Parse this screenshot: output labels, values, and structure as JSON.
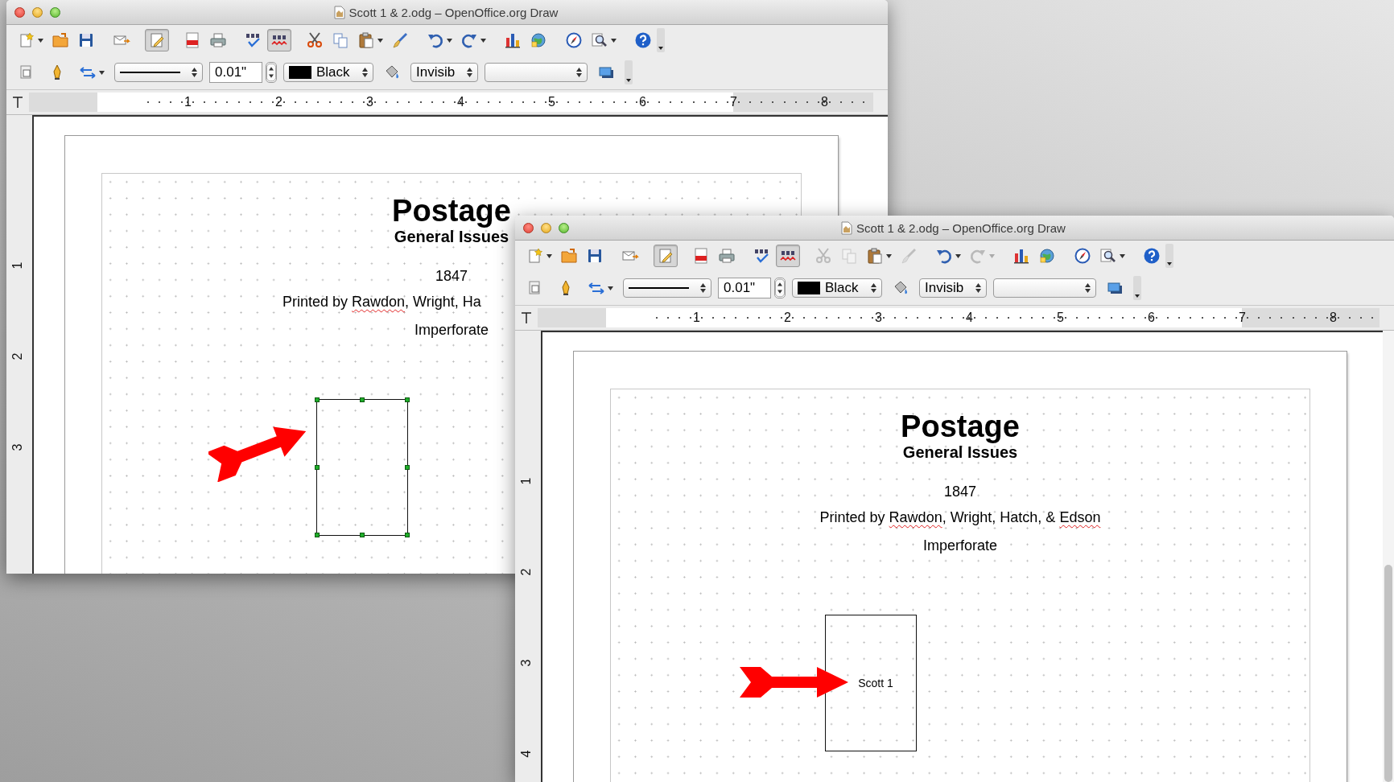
{
  "windows": [
    {
      "title": "Scott 1 & 2.odg – OpenOffice.org Draw",
      "standard_toolbar": [
        {
          "kind": "new",
          "dropdown": true,
          "disabled": false,
          "on": false
        },
        {
          "kind": "open",
          "dropdown": false,
          "disabled": false,
          "on": false
        },
        {
          "kind": "save",
          "dropdown": false,
          "disabled": false,
          "on": false
        },
        {
          "kind": "email",
          "dropdown": false,
          "disabled": false,
          "on": false
        },
        {
          "kind": "edit",
          "dropdown": false,
          "disabled": false,
          "on": true
        },
        {
          "kind": "pdf",
          "dropdown": false,
          "disabled": false,
          "on": false
        },
        {
          "kind": "print",
          "dropdown": false,
          "disabled": false,
          "on": false
        },
        {
          "kind": "spell",
          "dropdown": false,
          "disabled": false,
          "on": false
        },
        {
          "kind": "autospell",
          "dropdown": false,
          "disabled": false,
          "on": true
        },
        {
          "kind": "cut",
          "dropdown": false,
          "disabled": false,
          "on": false
        },
        {
          "kind": "copy",
          "dropdown": false,
          "disabled": false,
          "on": false
        },
        {
          "kind": "paste",
          "dropdown": true,
          "disabled": false,
          "on": false
        },
        {
          "kind": "brush",
          "dropdown": false,
          "disabled": false,
          "on": false
        },
        {
          "kind": "undo",
          "dropdown": true,
          "disabled": false,
          "on": false
        },
        {
          "kind": "redo",
          "dropdown": true,
          "disabled": false,
          "on": false
        },
        {
          "kind": "chart",
          "dropdown": false,
          "disabled": false,
          "on": false
        },
        {
          "kind": "gallery",
          "dropdown": false,
          "disabled": false,
          "on": false
        },
        {
          "kind": "navigator",
          "dropdown": false,
          "disabled": false,
          "on": false
        },
        {
          "kind": "zoom",
          "dropdown": true,
          "disabled": false,
          "on": false
        },
        {
          "kind": "help",
          "dropdown": false,
          "disabled": false,
          "on": false
        }
      ],
      "line_toolbar": [
        {
          "kind": "line-dialog"
        },
        {
          "kind": "pen"
        },
        {
          "kind": "arrows"
        },
        {
          "kind": "style-select"
        },
        {
          "kind": "width-field",
          "value": "0.01\""
        },
        {
          "kind": "spinner"
        },
        {
          "kind": "color-select",
          "label": "Black",
          "color": "#000000"
        },
        {
          "kind": "area-dialog"
        },
        {
          "kind": "fill-select",
          "label": "Invisib"
        },
        {
          "kind": "empty-select"
        },
        {
          "kind": "shadow"
        },
        {
          "kind": "more"
        }
      ],
      "h_ruler": [
        "1",
        "2",
        "3",
        "4",
        "5",
        "6",
        "7",
        "8"
      ],
      "v_ruler": [
        "1",
        "2",
        "3"
      ],
      "lines": [
        {
          "kind": "title",
          "text": "Postage",
          "cut_off": false
        },
        {
          "kind": "subtitle",
          "text": "General Issues",
          "cut_off": false
        },
        {
          "kind": "body",
          "text": "1847",
          "cut_off": false
        },
        {
          "kind": "body",
          "segments": [
            {
              "text": "Printed by ",
              "misspelled": false
            },
            {
              "text": "Rawdon",
              "misspelled": true
            },
            {
              "text": ", Wright, Ha",
              "misspelled": false
            }
          ],
          "cut_off": true
        },
        {
          "kind": "body",
          "text": "Imperforate",
          "cut_off": false
        }
      ],
      "arrow": {
        "kind": "diagonal"
      },
      "rectangle": {
        "selected": true
      }
    },
    {
      "title": "Scott 1 & 2.odg – OpenOffice.org Draw",
      "standard_toolbar": [
        {
          "kind": "new",
          "dropdown": true,
          "disabled": false,
          "on": false
        },
        {
          "kind": "open",
          "dropdown": false,
          "disabled": false,
          "on": false
        },
        {
          "kind": "save",
          "dropdown": false,
          "disabled": false,
          "on": false
        },
        {
          "kind": "email",
          "dropdown": false,
          "disabled": false,
          "on": false
        },
        {
          "kind": "edit",
          "dropdown": false,
          "disabled": false,
          "on": true
        },
        {
          "kind": "pdf",
          "dropdown": false,
          "disabled": false,
          "on": false
        },
        {
          "kind": "print",
          "dropdown": false,
          "disabled": false,
          "on": false
        },
        {
          "kind": "spell",
          "dropdown": false,
          "disabled": false,
          "on": false
        },
        {
          "kind": "autospell",
          "dropdown": false,
          "disabled": false,
          "on": true
        },
        {
          "kind": "cut",
          "dropdown": false,
          "disabled": true,
          "on": false
        },
        {
          "kind": "copy",
          "dropdown": false,
          "disabled": true,
          "on": false
        },
        {
          "kind": "paste",
          "dropdown": true,
          "disabled": false,
          "on": false
        },
        {
          "kind": "brush",
          "dropdown": false,
          "disabled": true,
          "on": false
        },
        {
          "kind": "undo",
          "dropdown": true,
          "disabled": false,
          "on": false
        },
        {
          "kind": "redo",
          "dropdown": true,
          "disabled": true,
          "on": false
        },
        {
          "kind": "chart",
          "dropdown": false,
          "disabled": false,
          "on": false
        },
        {
          "kind": "gallery",
          "dropdown": false,
          "disabled": false,
          "on": false
        },
        {
          "kind": "navigator",
          "dropdown": false,
          "disabled": false,
          "on": false
        },
        {
          "kind": "zoom",
          "dropdown": true,
          "disabled": false,
          "on": false
        },
        {
          "kind": "help",
          "dropdown": false,
          "disabled": false,
          "on": false
        }
      ],
      "line_toolbar": [
        {
          "kind": "line-dialog"
        },
        {
          "kind": "pen"
        },
        {
          "kind": "arrows"
        },
        {
          "kind": "style-select"
        },
        {
          "kind": "width-field",
          "value": "0.01\""
        },
        {
          "kind": "spinner"
        },
        {
          "kind": "color-select",
          "label": "Black",
          "color": "#000000"
        },
        {
          "kind": "area-dialog"
        },
        {
          "kind": "fill-select",
          "label": "Invisib"
        },
        {
          "kind": "empty-select"
        },
        {
          "kind": "shadow"
        },
        {
          "kind": "more"
        }
      ],
      "h_ruler": [
        "1",
        "2",
        "3",
        "4",
        "5",
        "6",
        "7",
        "8"
      ],
      "v_ruler": [
        "1",
        "2",
        "3",
        "4"
      ],
      "lines": [
        {
          "kind": "title",
          "text": "Postage",
          "cut_off": false
        },
        {
          "kind": "subtitle",
          "text": "General Issues",
          "cut_off": false
        },
        {
          "kind": "body",
          "text": "1847",
          "cut_off": false
        },
        {
          "kind": "body",
          "segments": [
            {
              "text": "Printed by ",
              "misspelled": false
            },
            {
              "text": "Rawdon",
              "misspelled": true
            },
            {
              "text": ", Wright, Hatch, & ",
              "misspelled": false
            },
            {
              "text": "Edson",
              "misspelled": true
            }
          ],
          "cut_off": false
        },
        {
          "kind": "body",
          "text": "Imperforate",
          "cut_off": false
        }
      ],
      "arrow": {
        "kind": "horizontal"
      },
      "rectangle": {
        "selected": false,
        "label": "Scott 1"
      }
    }
  ]
}
